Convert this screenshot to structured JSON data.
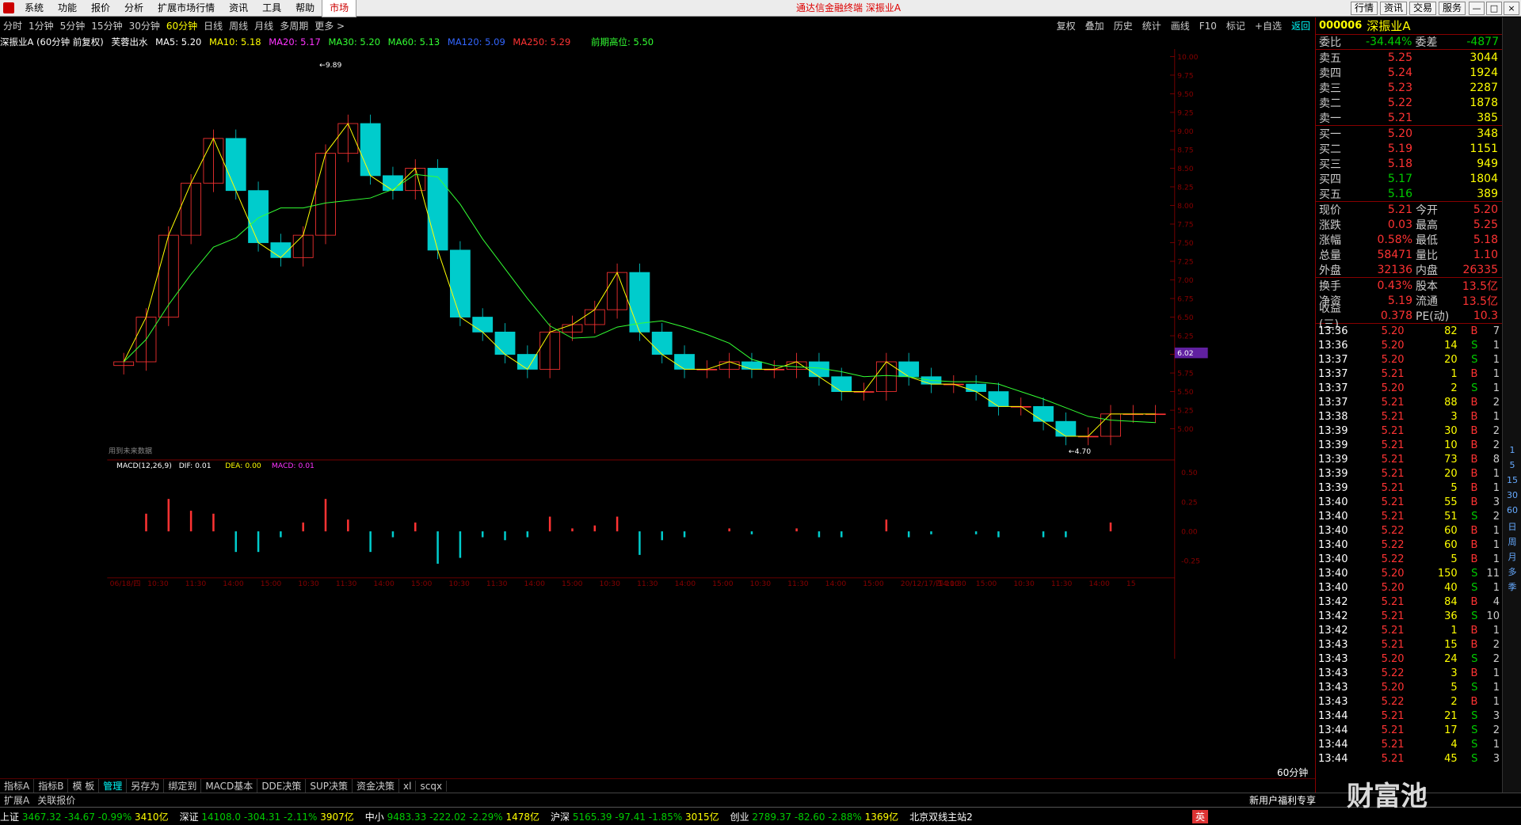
{
  "menubar": {
    "items": [
      "系统",
      "功能",
      "报价",
      "分析",
      "扩展市场行情",
      "资讯",
      "工具",
      "帮助"
    ],
    "active_item": "市场",
    "title": "通达信金融终端  深振业A",
    "quick_buttons": [
      "行情",
      "资讯",
      "交易",
      "服务"
    ],
    "window_buttons": [
      "—",
      "□",
      "×"
    ]
  },
  "periodbar": {
    "items": [
      "分时",
      "1分钟",
      "5分钟",
      "15分钟",
      "30分钟",
      "60分钟",
      "日线",
      "周线",
      "月线",
      "多周期",
      "更多 >"
    ],
    "selected": "60分钟"
  },
  "toolbar": {
    "items": [
      "复权",
      "叠加",
      "历史",
      "统计",
      "画线",
      "F10",
      "标记",
      "+自选",
      "返回"
    ]
  },
  "infobar": {
    "stock": "深振业A (60分钟 前复权)",
    "indicator": "芙蓉出水",
    "ma": [
      {
        "label": "MA5: 5.20",
        "color": "#ffffff"
      },
      {
        "label": "MA10: 5.18",
        "color": "#ffff00"
      },
      {
        "label": "MA20: 5.17",
        "color": "#ff33ff"
      },
      {
        "label": "MA30: 5.20",
        "color": "#33ff33"
      },
      {
        "label": "MA60: 5.13",
        "color": "#33ff33"
      },
      {
        "label": "MA120: 5.09",
        "color": "#3366ff"
      },
      {
        "label": "MA250: 5.29",
        "color": "#ff3333"
      }
    ],
    "peak": "前期高位: 5.50"
  },
  "chart_data": [
    {
      "type": "candlestick",
      "ylim": [
        4.6,
        10.1
      ],
      "y_ticks": [
        "10.00",
        "9.75",
        "9.50",
        "9.25",
        "9.00",
        "8.75",
        "8.50",
        "8.25",
        "8.00",
        "7.75",
        "7.50",
        "7.25",
        "7.00",
        "6.75",
        "6.50",
        "6.25",
        "6.00",
        "5.75",
        "5.50",
        "5.25",
        "5.00"
      ],
      "annotations": {
        "high": "9.89",
        "low": "4.70",
        "cursor_price": "6.02"
      },
      "x_labels": [
        "06/18/四",
        "10:30",
        "11:30",
        "14:00",
        "15:00",
        "10:30",
        "11:30",
        "14:00",
        "15:00",
        "10:30",
        "11:30",
        "14:00",
        "15:00",
        "10:30",
        "11:30",
        "14:00",
        "15:00",
        "10:30",
        "11:30",
        "14:00",
        "15:00",
        "20/12/17/四 11:30",
        "14:00",
        "15:00",
        "10:30",
        "11:30",
        "14:00",
        "15"
      ],
      "close": [
        5.9,
        6.5,
        7.6,
        8.3,
        8.9,
        8.2,
        7.5,
        7.3,
        7.6,
        8.7,
        9.1,
        8.4,
        8.2,
        8.5,
        7.4,
        6.5,
        6.3,
        6.0,
        5.8,
        6.3,
        6.4,
        6.6,
        7.1,
        6.3,
        6.0,
        5.8,
        5.8,
        5.9,
        5.8,
        5.8,
        5.9,
        5.7,
        5.5,
        5.5,
        5.9,
        5.7,
        5.6,
        5.6,
        5.5,
        5.3,
        5.3,
        5.1,
        4.9,
        4.9,
        5.2,
        5.2,
        5.2
      ],
      "note": "用到未来数据"
    },
    {
      "type": "bar",
      "title": "MACD(12,26,9)",
      "series": [
        {
          "name": "DIF",
          "value": "0.01"
        },
        {
          "name": "DEA",
          "value": "0.00"
        },
        {
          "name": "MACD",
          "value": "0.01"
        }
      ],
      "y_ticks": [
        "0.50",
        "0.25",
        "0.00",
        "-0.25"
      ],
      "ylim": [
        -0.35,
        0.55
      ]
    }
  ],
  "period_label": "60分钟",
  "quote": {
    "code": "000006",
    "name": "深振业A",
    "weibi_label": "委比",
    "weibi": "-34.44%",
    "weicha_label": "委差",
    "weicha": "-4877",
    "asks": [
      {
        "label": "卖五",
        "price": "5.25",
        "vol": "3044"
      },
      {
        "label": "卖四",
        "price": "5.24",
        "vol": "1924"
      },
      {
        "label": "卖三",
        "price": "5.23",
        "vol": "2287"
      },
      {
        "label": "卖二",
        "price": "5.22",
        "vol": "1878"
      },
      {
        "label": "卖一",
        "price": "5.21",
        "vol": "385"
      }
    ],
    "bids": [
      {
        "label": "买一",
        "price": "5.20",
        "vol": "348"
      },
      {
        "label": "买二",
        "price": "5.19",
        "vol": "1151"
      },
      {
        "label": "买三",
        "price": "5.18",
        "vol": "949"
      },
      {
        "label": "买四",
        "price": "5.17",
        "vol": "1804"
      },
      {
        "label": "买五",
        "price": "5.16",
        "vol": "389"
      }
    ],
    "stats": [
      {
        "l1": "现价",
        "v1": "5.21",
        "l2": "今开",
        "v2": "5.20"
      },
      {
        "l1": "涨跌",
        "v1": "0.03",
        "l2": "最高",
        "v2": "5.25"
      },
      {
        "l1": "涨幅",
        "v1": "0.58%",
        "l2": "最低",
        "v2": "5.18"
      },
      {
        "l1": "总量",
        "v1": "58471",
        "l2": "量比",
        "v2": "1.10"
      },
      {
        "l1": "外盘",
        "v1": "32136",
        "l2": "内盘",
        "v2": "26335"
      }
    ],
    "stats2": [
      {
        "l1": "换手",
        "v1": "0.43%",
        "l2": "股本",
        "v2": "13.5亿"
      },
      {
        "l1": "净资",
        "v1": "5.19",
        "l2": "流通",
        "v2": "13.5亿"
      },
      {
        "l1": "收益(三)",
        "v1": "0.378",
        "l2": "PE(动)",
        "v2": "10.3"
      }
    ]
  },
  "ticks": [
    [
      "13:36",
      "5.20",
      "82",
      "B",
      "7"
    ],
    [
      "13:36",
      "5.20",
      "14",
      "S",
      "1"
    ],
    [
      "13:37",
      "5.20",
      "20",
      "S",
      "1"
    ],
    [
      "13:37",
      "5.21",
      "1",
      "B",
      "1"
    ],
    [
      "13:37",
      "5.20",
      "2",
      "S",
      "1"
    ],
    [
      "13:37",
      "5.21",
      "88",
      "B",
      "2"
    ],
    [
      "13:38",
      "5.21",
      "3",
      "B",
      "1"
    ],
    [
      "13:39",
      "5.21",
      "30",
      "B",
      "2"
    ],
    [
      "13:39",
      "5.21",
      "10",
      "B",
      "2"
    ],
    [
      "13:39",
      "5.21",
      "73",
      "B",
      "8"
    ],
    [
      "13:39",
      "5.21",
      "20",
      "B",
      "1"
    ],
    [
      "13:39",
      "5.21",
      "5",
      "B",
      "1"
    ],
    [
      "13:40",
      "5.21",
      "55",
      "B",
      "3"
    ],
    [
      "13:40",
      "5.21",
      "51",
      "S",
      "2"
    ],
    [
      "13:40",
      "5.22",
      "60",
      "B",
      "1"
    ],
    [
      "13:40",
      "5.22",
      "60",
      "B",
      "1"
    ],
    [
      "13:40",
      "5.22",
      "5",
      "B",
      "1"
    ],
    [
      "13:40",
      "5.20",
      "150",
      "S",
      "11"
    ],
    [
      "13:40",
      "5.20",
      "40",
      "S",
      "1"
    ],
    [
      "13:42",
      "5.21",
      "84",
      "B",
      "4"
    ],
    [
      "13:42",
      "5.21",
      "36",
      "S",
      "10"
    ],
    [
      "13:42",
      "5.21",
      "1",
      "B",
      "1"
    ],
    [
      "13:43",
      "5.21",
      "15",
      "B",
      "2"
    ],
    [
      "13:43",
      "5.20",
      "24",
      "S",
      "2"
    ],
    [
      "13:43",
      "5.22",
      "3",
      "B",
      "1"
    ],
    [
      "13:43",
      "5.20",
      "5",
      "S",
      "1"
    ],
    [
      "13:43",
      "5.22",
      "2",
      "B",
      "1"
    ],
    [
      "13:44",
      "5.21",
      "21",
      "S",
      "3"
    ],
    [
      "13:44",
      "5.21",
      "17",
      "S",
      "2"
    ],
    [
      "13:44",
      "5.21",
      "4",
      "S",
      "1"
    ],
    [
      "13:44",
      "5.21",
      "45",
      "S",
      "3"
    ]
  ],
  "side_icons": [
    "1",
    "5",
    "15",
    "30",
    "60",
    "日",
    "周",
    "月",
    "多",
    "季"
  ],
  "bottomtabs": [
    "指标A",
    "指标B",
    "模 板",
    "管理",
    "另存为",
    "绑定到",
    "MACD基本",
    "DDE决策",
    "SUP决策",
    "资金决策",
    "xl",
    "scqx"
  ],
  "bottomtabs_selected": "管理",
  "bottom2": [
    "扩展A",
    "关联报价"
  ],
  "bottom2_right": "新用户福利专享",
  "statusbar": [
    {
      "name": "上证",
      "val": "3467.32",
      "chg": "-34.67",
      "pct": "-0.99%",
      "amt": "3410亿"
    },
    {
      "name": "深证",
      "val": "14108.0",
      "chg": "-304.31",
      "pct": "-2.11%",
      "amt": "3907亿"
    },
    {
      "name": "中小",
      "val": "9483.33",
      "chg": "-222.02",
      "pct": "-2.29%",
      "amt": "1478亿"
    },
    {
      "name": "沪深",
      "val": "5165.39",
      "chg": "-97.41",
      "pct": "-1.85%",
      "amt": "3015亿"
    },
    {
      "name": "创业",
      "val": "2789.37",
      "chg": "-82.60",
      "pct": "-2.88%",
      "amt": "1369亿"
    }
  ],
  "status_right": "北京双线主站2",
  "ime": "英",
  "watermark": "财富池"
}
